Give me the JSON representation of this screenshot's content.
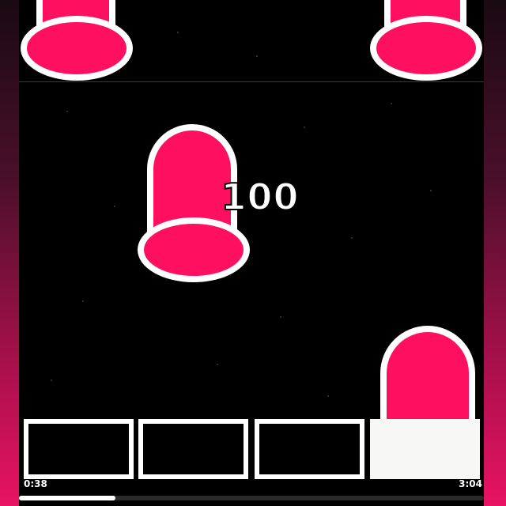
{
  "game": {
    "score": "100",
    "elapsed_time": "0:38",
    "total_time": "3:04",
    "progress": 0.207,
    "lanes": [
      {
        "name": "lane-1",
        "active": false
      },
      {
        "name": "lane-2",
        "active": false
      },
      {
        "name": "lane-3",
        "active": false
      },
      {
        "name": "lane-4",
        "active": true
      }
    ]
  },
  "colors": {
    "note_fill": "#ff0f5f",
    "note_outline": "#ffffff",
    "background": "#000000",
    "side_gradient_bottom": "#e81363"
  }
}
